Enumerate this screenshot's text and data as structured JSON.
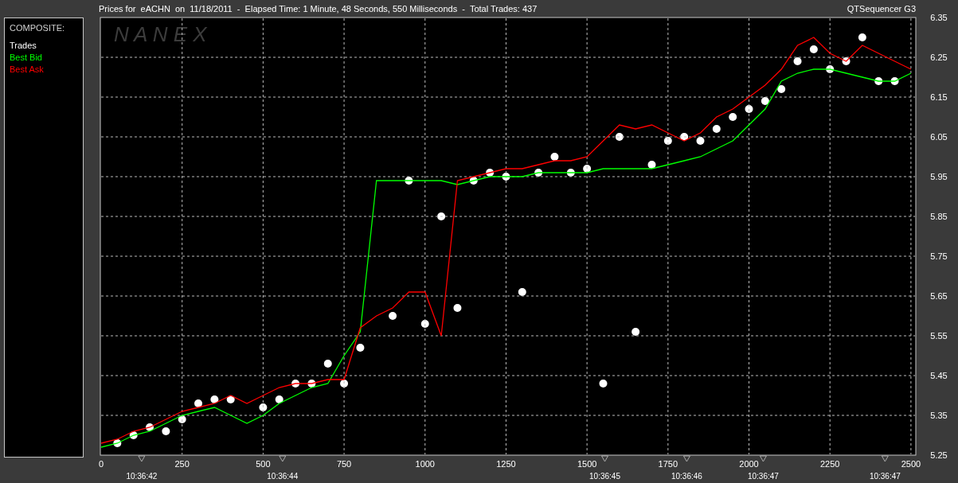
{
  "window": {
    "title": "Prices for  eACHN  on  11/18/2011  -  Elapsed Time: 1 Minute, 48 Seconds, 550 Milliseconds  -  Total Trades: 437",
    "app_name": "QTSequencer G3"
  },
  "legend": {
    "title": "COMPOSITE:"
  },
  "chart": {
    "logo": "N A N E X",
    "time_labels": [
      "10:36:42",
      "10:36:44",
      "10:36:45",
      "10:36:46",
      "10:36:47",
      "10:36:47"
    ],
    "chart_data": {
      "type": "line",
      "grid": true,
      "x": [
        0,
        50,
        100,
        150,
        200,
        250,
        300,
        350,
        400,
        450,
        500,
        550,
        600,
        650,
        700,
        750,
        800,
        850,
        900,
        950,
        1000,
        1050,
        1100,
        1150,
        1200,
        1250,
        1300,
        1350,
        1400,
        1450,
        1500,
        1550,
        1600,
        1650,
        1700,
        1750,
        1800,
        1850,
        1900,
        1950,
        2000,
        2050,
        2100,
        2150,
        2200,
        2250,
        2300,
        2350,
        2400,
        2450,
        2500
      ],
      "xlim": [
        0,
        2515
      ],
      "ylim": [
        5.25,
        6.35
      ],
      "xticks": [
        0,
        250,
        500,
        750,
        1000,
        1250,
        1500,
        1750,
        2000,
        2250,
        2500
      ],
      "yticks": [
        {
          "value": 5.25,
          "label": "5.25"
        },
        {
          "value": 5.35,
          "label": "5.35"
        },
        {
          "value": 5.45,
          "label": "5.45"
        },
        {
          "value": 5.55,
          "label": "5.55"
        },
        {
          "value": 5.65,
          "label": "5.65"
        },
        {
          "value": 5.75,
          "label": "5.75"
        },
        {
          "value": 5.85,
          "label": "5.85"
        },
        {
          "value": 5.95,
          "label": "5.95"
        },
        {
          "value": 6.05,
          "label": "6.05"
        },
        {
          "value": 6.15,
          "label": "6.15"
        },
        {
          "value": 6.25,
          "label": "6.25"
        },
        {
          "value": 6.35,
          "label": "6.35"
        }
      ],
      "series": [
        {
          "name": "Best Bid",
          "color": "#00ff00",
          "values": [
            5.27,
            5.28,
            5.3,
            5.31,
            5.33,
            5.35,
            5.36,
            5.37,
            5.35,
            5.33,
            5.35,
            5.38,
            5.4,
            5.42,
            5.43,
            5.5,
            5.56,
            5.94,
            5.94,
            5.94,
            5.94,
            5.94,
            5.93,
            5.94,
            5.95,
            5.95,
            5.95,
            5.96,
            5.96,
            5.96,
            5.96,
            5.97,
            5.97,
            5.97,
            5.97,
            5.98,
            5.99,
            6.0,
            6.02,
            6.04,
            6.08,
            6.12,
            6.19,
            6.21,
            6.22,
            6.22,
            6.21,
            6.2,
            6.19,
            6.19,
            6.21
          ]
        },
        {
          "name": "Best Ask",
          "color": "#ff0000",
          "values": [
            5.28,
            5.29,
            5.31,
            5.32,
            5.34,
            5.36,
            5.37,
            5.38,
            5.4,
            5.38,
            5.4,
            5.42,
            5.43,
            5.43,
            5.44,
            5.44,
            5.57,
            5.6,
            5.62,
            5.66,
            5.66,
            5.55,
            5.94,
            5.95,
            5.96,
            5.97,
            5.97,
            5.98,
            5.99,
            5.99,
            6.0,
            6.04,
            6.08,
            6.07,
            6.08,
            6.06,
            6.04,
            6.06,
            6.1,
            6.12,
            6.15,
            6.18,
            6.22,
            6.28,
            6.3,
            6.26,
            6.24,
            6.28,
            6.26,
            6.24,
            6.22
          ]
        }
      ]
    },
    "trades_layer": {
      "chart_data": {
        "type": "scatter",
        "x": [
          50,
          100,
          150,
          200,
          250,
          300,
          350,
          400,
          500,
          550,
          600,
          650,
          700,
          750,
          800,
          900,
          950,
          1000,
          1050,
          1100,
          1150,
          1200,
          1250,
          1300,
          1350,
          1400,
          1450,
          1500,
          1550,
          1600,
          1650,
          1700,
          1750,
          1800,
          1850,
          1900,
          1950,
          2000,
          2050,
          2100,
          2150,
          2200,
          2250,
          2300,
          2350,
          2400,
          2450
        ],
        "xlim": [
          0,
          2515
        ],
        "ylim": [
          5.25,
          6.35
        ],
        "series": [
          {
            "name": "Trades",
            "color": "#ffffff",
            "values": [
              5.28,
              5.3,
              5.32,
              5.31,
              5.34,
              5.38,
              5.39,
              5.39,
              5.37,
              5.39,
              5.43,
              5.43,
              5.48,
              5.43,
              5.52,
              5.6,
              5.94,
              5.58,
              5.85,
              5.62,
              5.94,
              5.96,
              5.95,
              5.66,
              5.96,
              6.0,
              5.96,
              5.97,
              5.43,
              6.05,
              5.56,
              5.98,
              6.04,
              6.05,
              6.04,
              6.07,
              6.1,
              6.12,
              6.14,
              6.17,
              6.24,
              6.27,
              6.22,
              6.24,
              6.3,
              6.19,
              6.19
            ]
          }
        ]
      }
    }
  }
}
